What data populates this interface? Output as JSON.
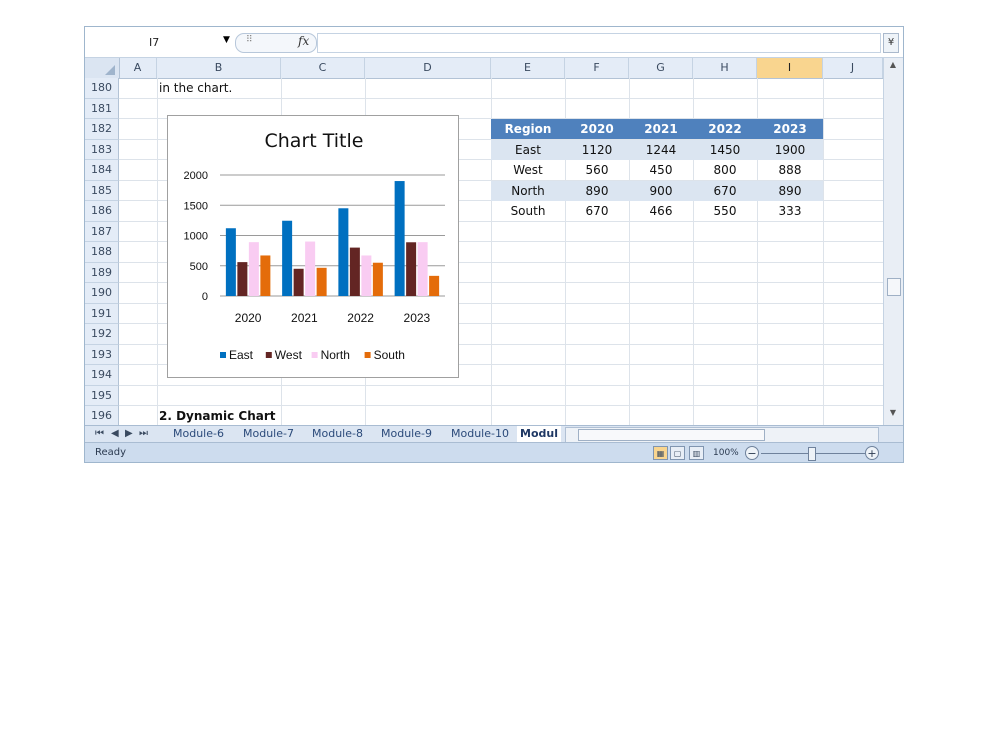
{
  "formula_bar": {
    "name_box": "I7",
    "fx_symbol": "fx",
    "formula": ""
  },
  "columns": [
    "A",
    "B",
    "C",
    "D",
    "E",
    "F",
    "G",
    "H",
    "I",
    "J"
  ],
  "selected_column": "I",
  "rows": [
    "180",
    "181",
    "182",
    "183",
    "184",
    "185",
    "186",
    "187",
    "188",
    "189",
    "190",
    "191",
    "192",
    "193",
    "194",
    "195",
    "196"
  ],
  "cells": {
    "b180": "in the chart.",
    "b196": "2. Dynamic Chart"
  },
  "table": {
    "headers": [
      "Region",
      "2020",
      "2021",
      "2022",
      "2023"
    ],
    "rows": [
      [
        "East",
        "1120",
        "1244",
        "1450",
        "1900"
      ],
      [
        "West",
        "560",
        "450",
        "800",
        "888"
      ],
      [
        "North",
        "890",
        "900",
        "670",
        "890"
      ],
      [
        "South",
        "670",
        "466",
        "550",
        "333"
      ]
    ]
  },
  "chart_data": {
    "type": "bar",
    "title": "Chart Title",
    "categories": [
      "2020",
      "2021",
      "2022",
      "2023"
    ],
    "series": [
      {
        "name": "East",
        "values": [
          1120,
          1244,
          1450,
          1900
        ],
        "color": "#0070c0"
      },
      {
        "name": "West",
        "values": [
          560,
          450,
          800,
          888
        ],
        "color": "#632523"
      },
      {
        "name": "North",
        "values": [
          890,
          900,
          670,
          890
        ],
        "color": "#f9ccf2"
      },
      {
        "name": "South",
        "values": [
          670,
          466,
          550,
          333
        ],
        "color": "#e46c0a"
      }
    ],
    "y_ticks": [
      "0",
      "500",
      "1000",
      "1500",
      "2000"
    ],
    "ylim": [
      0,
      2000
    ],
    "grid": true,
    "legend": "bottom"
  },
  "sheet_tabs": [
    "Module-6",
    "Module-7",
    "Module-8",
    "Module-9",
    "Module-10",
    "Modul"
  ],
  "active_tab": "Modul",
  "status": {
    "ready": "Ready",
    "zoom": "100%",
    "zoom_minus": "−",
    "zoom_plus": "+"
  },
  "colors": {
    "header_blue": "#4f81bd",
    "band_blue": "#dbe5f1",
    "selected_col": "#f9d58f"
  }
}
